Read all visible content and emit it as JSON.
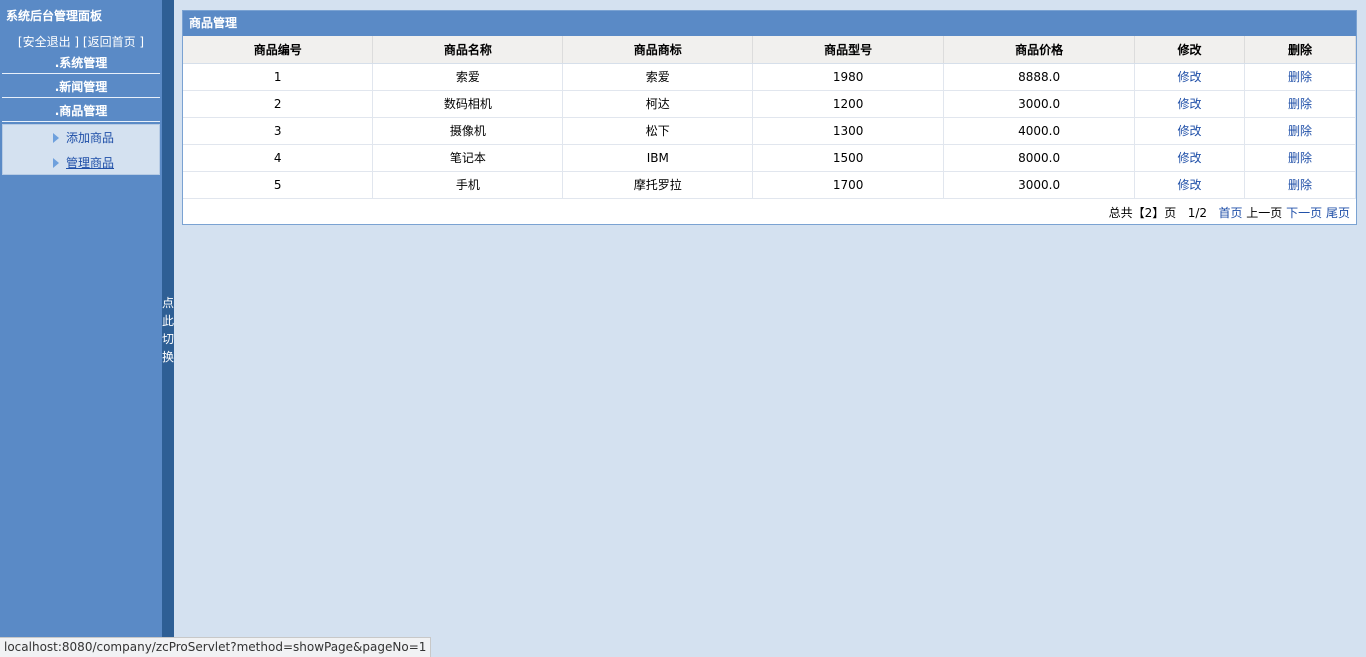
{
  "sidebar": {
    "title": "系统后台管理面板",
    "logout": "[安全退出 ]",
    "home": "[返回首页 ]",
    "menus": [
      ".系统管理",
      ".新闻管理",
      ".商品管理"
    ],
    "submenu": [
      "添加商品",
      "管理商品"
    ]
  },
  "toggle": {
    "chars": [
      "点",
      "此",
      "切",
      "换"
    ]
  },
  "panel": {
    "title": "商品管理",
    "headers": [
      "商品编号",
      "商品名称",
      "商品商标",
      "商品型号",
      "商品价格",
      "修改",
      "删除"
    ],
    "rows": [
      [
        "1",
        "索爱",
        "索爱",
        "1980",
        "8888.0",
        "修改",
        "删除"
      ],
      [
        "2",
        "数码相机",
        "柯达",
        "1200",
        "3000.0",
        "修改",
        "删除"
      ],
      [
        "3",
        "摄像机",
        "松下",
        "1300",
        "4000.0",
        "修改",
        "删除"
      ],
      [
        "4",
        "笔记本",
        "IBM",
        "1500",
        "8000.0",
        "修改",
        "删除"
      ],
      [
        "5",
        "手机",
        "摩托罗拉",
        "1700",
        "3000.0",
        "修改",
        "删除"
      ]
    ],
    "pager": {
      "total": "总共【2】页",
      "page": "1/2",
      "first": "首页",
      "prev": "上一页",
      "next": "下一页",
      "last": "尾页"
    }
  },
  "status_url": "localhost:8080/company/zcProServlet?method=showPage&pageNo=1"
}
